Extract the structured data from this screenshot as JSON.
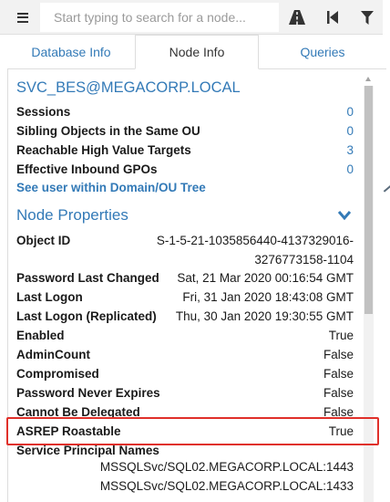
{
  "search": {
    "placeholder": "Start typing to search for a node..."
  },
  "tabs": [
    {
      "label": "Database Info"
    },
    {
      "label": "Node Info"
    },
    {
      "label": "Queries"
    }
  ],
  "node": {
    "name": "SVC_BES@MEGACORP.LOCAL",
    "summary": [
      {
        "label": "Sessions",
        "value": "0"
      },
      {
        "label": "Sibling Objects in the Same OU",
        "value": "0"
      },
      {
        "label": "Reachable High Value Targets",
        "value": "3"
      },
      {
        "label": "Effective Inbound GPOs",
        "value": "0"
      }
    ],
    "tree_link": "See user within Domain/OU Tree"
  },
  "properties": {
    "title": "Node Properties",
    "object_id": {
      "label": "Object ID",
      "value": "S-1-5-21-1035856440-4137329016-3276773158-1104"
    },
    "rows": [
      {
        "label": "Password Last Changed",
        "value": "Sat, 21 Mar 2020 00:16:54 GMT"
      },
      {
        "label": "Last Logon",
        "value": "Fri, 31 Jan 2020 18:43:08 GMT"
      },
      {
        "label": "Last Logon (Replicated)",
        "value": "Thu, 30 Jan 2020 19:30:55 GMT"
      },
      {
        "label": "Enabled",
        "value": "True"
      },
      {
        "label": "AdminCount",
        "value": "False"
      },
      {
        "label": "Compromised",
        "value": "False"
      },
      {
        "label": "Password Never Expires",
        "value": "False"
      },
      {
        "label": "Cannot Be Delegated",
        "value": "False"
      },
      {
        "label": "ASREP Roastable",
        "value": "True"
      }
    ],
    "spn_label": "Service Principal Names",
    "spns": [
      "MSSQLSvc/SQL02.MEGACORP.LOCAL:1443",
      "MSSQLSvc/SQL02.MEGACORP.LOCAL:1433"
    ]
  },
  "colors": {
    "accent": "#337ab7",
    "highlight": "#e0302a"
  }
}
